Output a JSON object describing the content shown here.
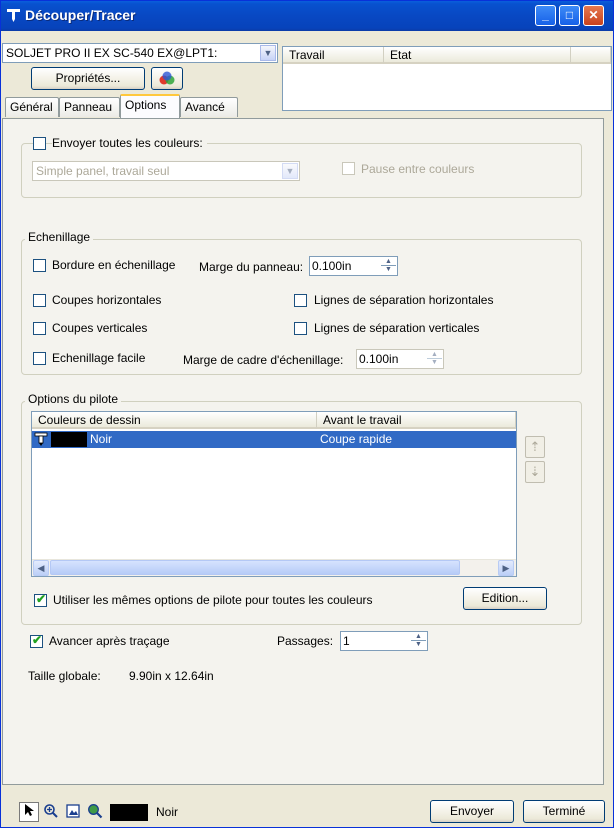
{
  "window": {
    "title": "Découper/Tracer",
    "controls": {
      "minimize": "_",
      "maximize": "□",
      "close": "✕"
    }
  },
  "device": {
    "selected": "SOLJET PRO II EX SC-540 EX@LPT1:",
    "properties_label": "Propriétés..."
  },
  "jobs": {
    "columns": [
      "Travail",
      "Etat"
    ],
    "rows": []
  },
  "tabs": [
    {
      "label": "Général",
      "active": false
    },
    {
      "label": "Panneau",
      "active": false
    },
    {
      "label": "Options",
      "active": true
    },
    {
      "label": "Avancé",
      "active": false
    }
  ],
  "colors": {
    "send_all_label": "Envoyer toutes les couleurs:",
    "send_all_checked": false,
    "mode_value": "Simple panel, travail seul",
    "pause_label": "Pause entre couleurs",
    "pause_checked": false
  },
  "tiling": {
    "title": "Echenillage",
    "border_label": "Bordure en échenillage",
    "panel_margin_label": "Marge du panneau:",
    "panel_margin_value": "0.100in",
    "horizontal_cuts": "Coupes horizontales",
    "horizontal_lines": "Lignes de séparation horizontales",
    "vertical_cuts": "Coupes verticales",
    "vertical_lines": "Lignes de séparation verticales",
    "easy_weeding": "Echenillage facile",
    "frame_margin_label": "Marge de cadre d'échenillage:",
    "frame_margin_value": "0.100in"
  },
  "driver": {
    "title": "Options du pilote",
    "columns": [
      "Couleurs de dessin",
      "Avant le travail"
    ],
    "rows": [
      {
        "color_name": "Noir",
        "swatch": "#000000",
        "before_job": "Coupe rapide"
      }
    ],
    "same_options_label": "Utiliser les mêmes options de pilote pour toutes les couleurs",
    "same_options_checked": true,
    "edit_label": "Edition..."
  },
  "advance": {
    "label": "Avancer après traçage",
    "checked": true,
    "passes_label": "Passages:",
    "passes_value": "1"
  },
  "size": {
    "label": "Taille globale:",
    "value": "9.90in x 12.64in"
  },
  "footer": {
    "current_color": "Noir",
    "current_swatch": "#000000",
    "send_label": "Envoyer",
    "done_label": "Terminé"
  },
  "accent": {
    "title_blue": "#0851cf",
    "selection_blue": "#316ac5",
    "check_green": "#21a121"
  }
}
